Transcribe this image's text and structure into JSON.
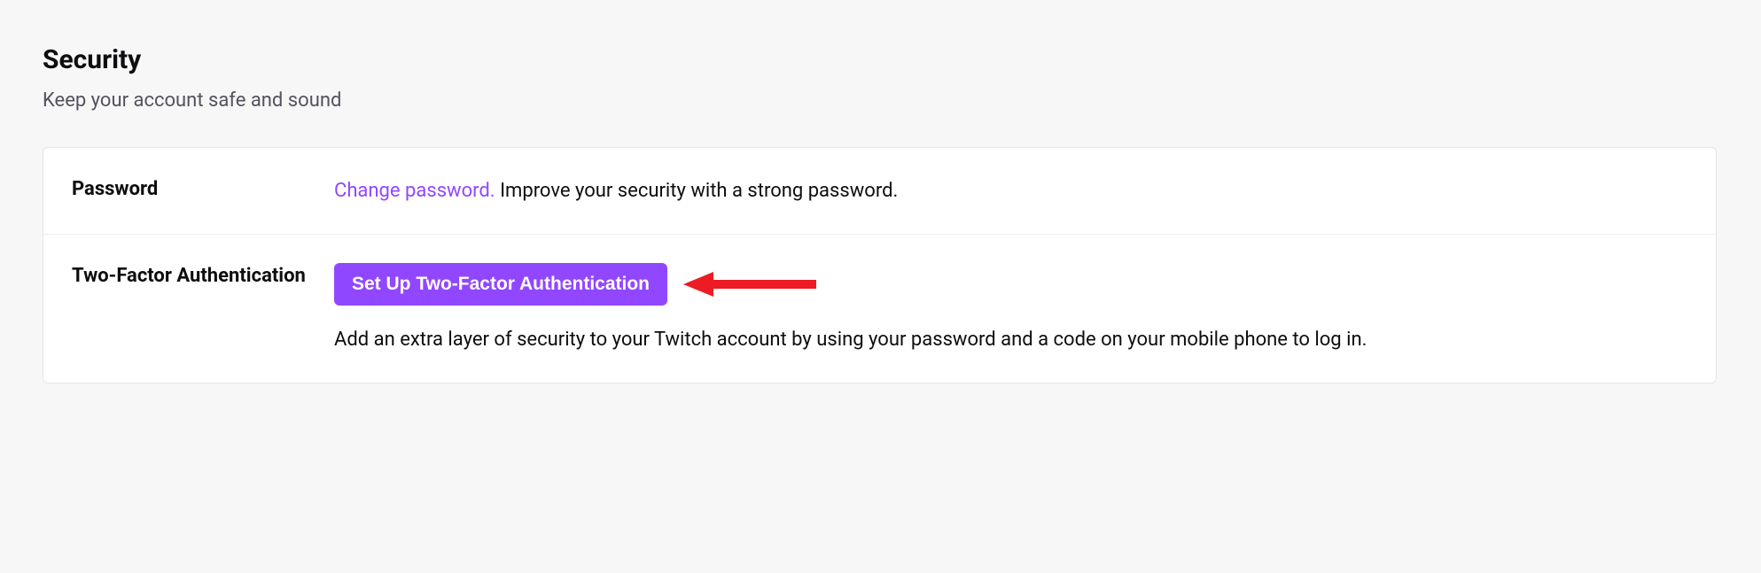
{
  "section": {
    "title": "Security",
    "subtitle": "Keep your account safe and sound"
  },
  "rows": {
    "password": {
      "label": "Password",
      "link_text": "Change password.",
      "description": " Improve your security with a strong password."
    },
    "twofa": {
      "label": "Two-Factor Authentication",
      "button_label": "Set Up Two-Factor Authentication",
      "description": "Add an extra layer of security to your Twitch account by using your password and a code on your mobile phone to log in."
    }
  },
  "colors": {
    "accent": "#9147ff",
    "annotation": "#ed1c24"
  }
}
